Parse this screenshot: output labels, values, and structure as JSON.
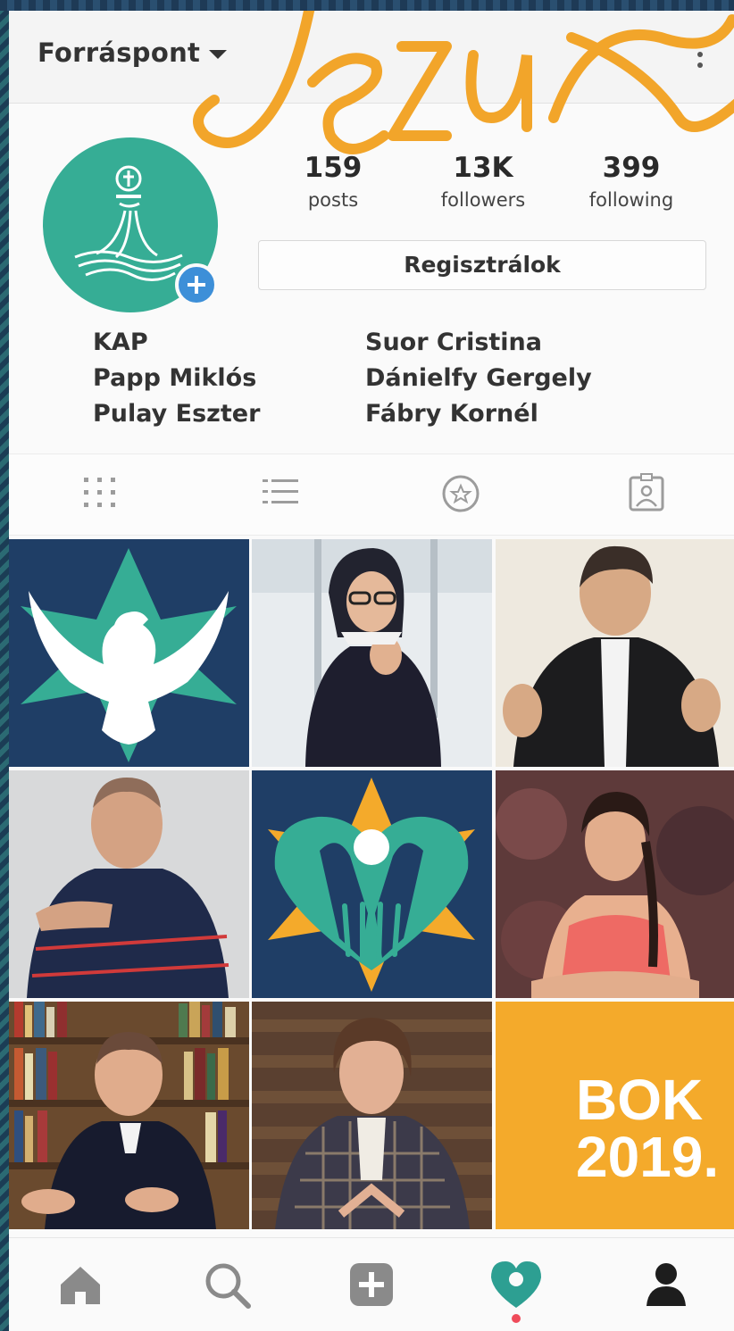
{
  "header": {
    "account_name": "Forráspont",
    "logo_script_text": "Jezus"
  },
  "profile": {
    "stats": [
      {
        "value": "159",
        "label": "posts"
      },
      {
        "value": "13K",
        "label": "followers"
      },
      {
        "value": "399",
        "label": "following"
      }
    ],
    "register_label": "Regisztrálok",
    "bio_left": [
      "KAP",
      "Papp Miklós",
      "Pulay Eszter"
    ],
    "bio_right": [
      "Suor Cristina",
      "Dánielfy Gergely",
      "Fábry Kornél"
    ]
  },
  "tabs": [
    "grid-icon",
    "list-icon",
    "tagged-icon",
    "saved-icon"
  ],
  "grid": {
    "banner_lines": [
      "BOK",
      "2019."
    ]
  },
  "bottom_nav": [
    "home-icon",
    "search-icon",
    "add-icon",
    "activity-icon",
    "profile-icon"
  ],
  "colors": {
    "teal": "#36ad95",
    "navy": "#1f3e66",
    "orange": "#f4aa2b",
    "accent_blue": "#3d8fd8",
    "notification_dot": "#ef4b5a"
  }
}
